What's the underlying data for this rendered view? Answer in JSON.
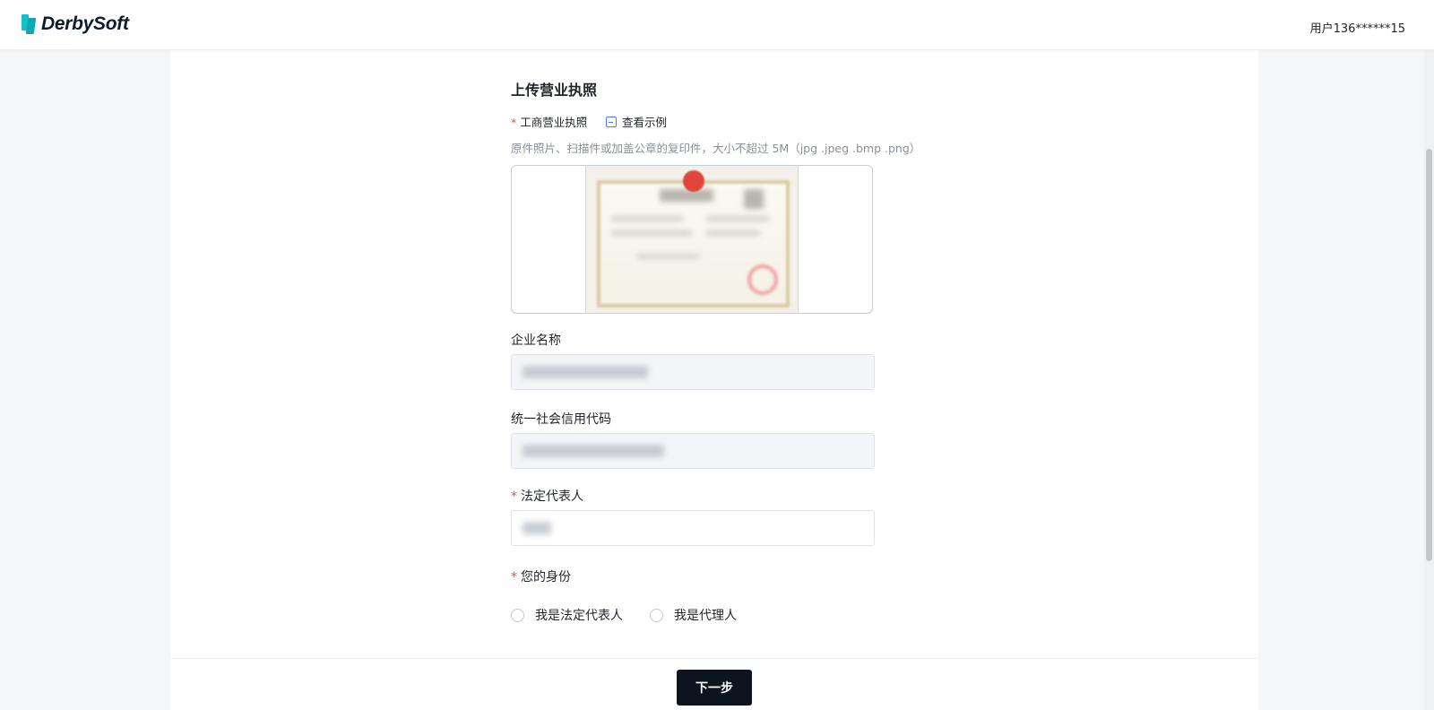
{
  "header": {
    "logo_text": "DerbySoft",
    "user_label": "用户136******15"
  },
  "form": {
    "section_title": "上传营业执照",
    "license": {
      "required_mark": "*",
      "label": "工商营业执照",
      "example_link": "查看示例",
      "hint": "原件照片、扫描件或加盖公章的复印件，大小不超过 5M（jpg .jpeg .bmp .png）"
    },
    "company_name": {
      "label": "企业名称"
    },
    "credit_code": {
      "label": "统一社会信用代码"
    },
    "legal_rep": {
      "required_mark": "*",
      "label": "法定代表人"
    },
    "identity": {
      "required_mark": "*",
      "label": "您的身份",
      "options": [
        "我是法定代表人",
        "我是代理人"
      ]
    }
  },
  "footer": {
    "next_label": "下一步"
  },
  "colors": {
    "accent": "#0c1420",
    "required": "#f04b4b",
    "link_icon": "#4a7cf0",
    "page_bg": "#f5f6f8"
  }
}
